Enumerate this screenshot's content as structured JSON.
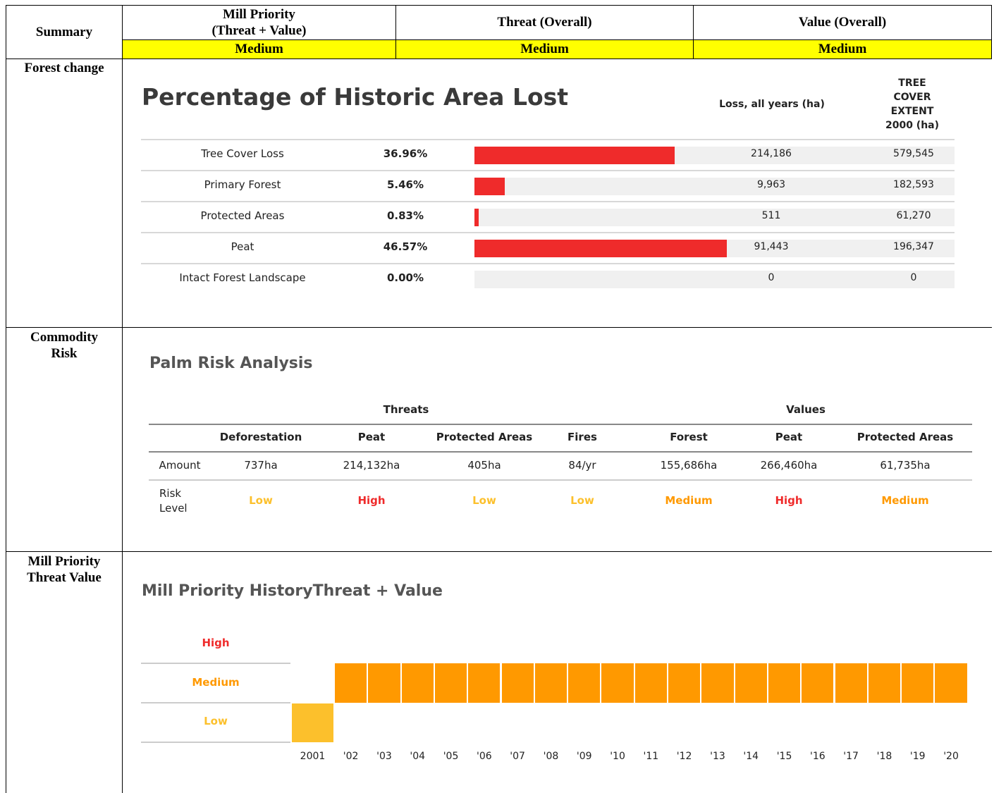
{
  "colors": {
    "high": "#ef2b2b",
    "medium": "#ff9900",
    "low": "#fcc02c",
    "bar": "#ef2b2b",
    "highlight": "#ffff00"
  },
  "summary": {
    "label": "Summary",
    "cols": [
      {
        "header": "Mill Priority (Threat + Value)",
        "value": "Medium"
      },
      {
        "header": "Threat (Overall)",
        "value": "Medium"
      },
      {
        "header": "Value (Overall)",
        "value": "Medium"
      }
    ],
    "mill_header_line1": "Mill Priority",
    "mill_header_line2": "(Threat + Value)"
  },
  "sections": {
    "forest_change": "Forest change",
    "commodity_risk_line1": "Commodity",
    "commodity_risk_line2": "Risk",
    "mill_priority_line1": "Mill Priority",
    "mill_priority_line2": "Threat Value"
  },
  "forest": {
    "title": "Percentage of Historic Area Lost",
    "col_loss": "Loss, all years (ha)",
    "col_extent_lines": [
      "TREE",
      "COVER",
      "EXTENT",
      "2000 (ha)"
    ],
    "rows": [
      {
        "label": "Tree Cover Loss",
        "pct": "36.96%",
        "frac": 0.4174,
        "loss": "214,186",
        "extent": "579,545"
      },
      {
        "label": "Primary Forest",
        "pct": "5.46%",
        "frac": 0.063,
        "loss": "9,963",
        "extent": "182,593"
      },
      {
        "label": "Protected Areas",
        "pct": "0.83%",
        "frac": 0.0095,
        "loss": "511",
        "extent": "61,270"
      },
      {
        "label": "Peat",
        "pct": "46.57%",
        "frac": 0.5257,
        "loss": "91,443",
        "extent": "196,347"
      },
      {
        "label": "Intact Forest Landscape",
        "pct": "0.00%",
        "frac": 0.0,
        "loss": "0",
        "extent": "0"
      }
    ]
  },
  "palm": {
    "title": "Palm Risk Analysis",
    "threats_label": "Threats",
    "values_label": "Values",
    "columns": [
      "Deforestation",
      "Peat",
      "Protected Areas",
      "Fires",
      "Forest",
      "Peat",
      "Protected Areas"
    ],
    "amount_label": "Amount",
    "amounts": [
      "737ha",
      "214,132ha",
      "405ha",
      "84/yr",
      "155,686ha",
      "266,460ha",
      "61,735ha"
    ],
    "risk_label_line1": "Risk",
    "risk_label_line2": "Level",
    "risks": [
      {
        "text": "Low",
        "level": "low"
      },
      {
        "text": "High",
        "level": "high"
      },
      {
        "text": "Low",
        "level": "low"
      },
      {
        "text": "Low",
        "level": "low"
      },
      {
        "text": "Medium",
        "level": "medium"
      },
      {
        "text": "High",
        "level": "high"
      },
      {
        "text": "Medium",
        "level": "medium"
      }
    ]
  },
  "mill_history": {
    "title": "Mill Priority HistoryThreat + Value",
    "levels": {
      "high": "High",
      "medium": "Medium",
      "low": "Low"
    },
    "years": [
      "2001",
      "'02",
      "'03",
      "'04",
      "'05",
      "'06",
      "'07",
      "'08",
      "'09",
      "'10",
      "'11",
      "'12",
      "'13",
      "'14",
      "'15",
      "'16",
      "'17",
      "'18",
      "'19",
      "'20"
    ],
    "values": [
      "low",
      "medium",
      "medium",
      "medium",
      "medium",
      "medium",
      "medium",
      "medium",
      "medium",
      "medium",
      "medium",
      "medium",
      "medium",
      "medium",
      "medium",
      "medium",
      "medium",
      "medium",
      "medium",
      "medium"
    ]
  }
}
